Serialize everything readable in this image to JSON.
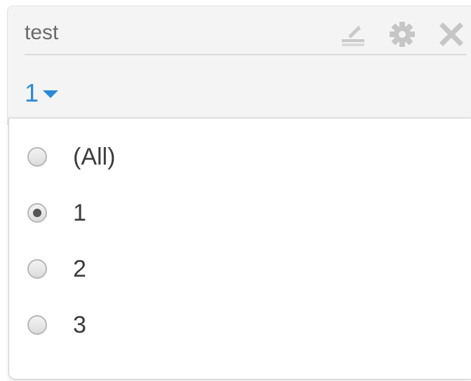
{
  "widget": {
    "title": "test",
    "icons": [
      "export-icon",
      "gear-icon",
      "close-icon"
    ],
    "selected_value": "1",
    "accent_color": "#2a8ad8"
  },
  "dropdown": {
    "options": [
      {
        "label": "(All)",
        "checked": false
      },
      {
        "label": "1",
        "checked": true
      },
      {
        "label": "2",
        "checked": false
      },
      {
        "label": "3",
        "checked": false
      }
    ]
  }
}
